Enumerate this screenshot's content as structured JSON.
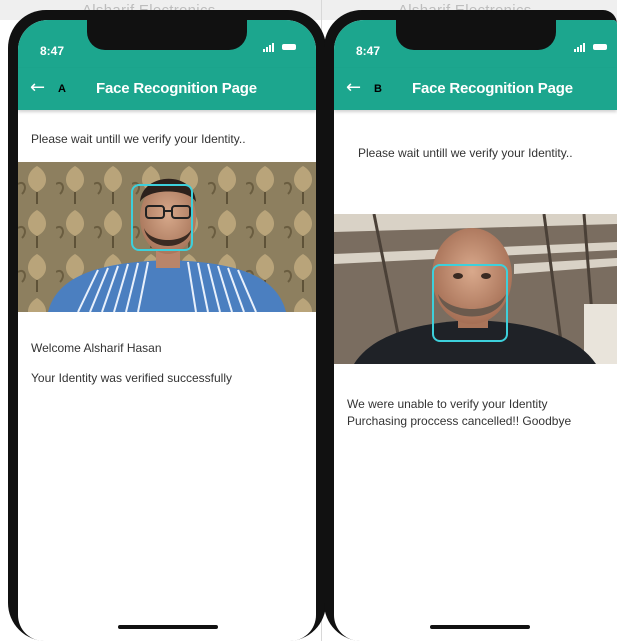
{
  "background": {
    "ghost_text_a": "Alsharif Electronics ...",
    "ghost_text_b": "Alsharif Electronics ..."
  },
  "colors": {
    "accent": "#1ca68e",
    "face_box": "#3dd0db",
    "text": "#333333"
  },
  "panel_a": {
    "label": "A",
    "status_time": "8:47",
    "app_title": "Face Recognition Page",
    "back_icon": "arrow-left-icon",
    "wait_text": "Please wait untill we verify your Identity..",
    "welcome_text": "Welcome Alsharif Hasan",
    "result_text": "Your Identity was verified successfully"
  },
  "panel_b": {
    "label": "B",
    "status_time": "8:47",
    "app_title": "Face Recognition Page",
    "back_icon": "arrow-left-icon",
    "wait_text": "Please wait untill we verify your Identity..",
    "result_line1": "We were unable to verify your Identity",
    "result_line2": "Purchasing proccess cancelled!!  Goodbye"
  }
}
